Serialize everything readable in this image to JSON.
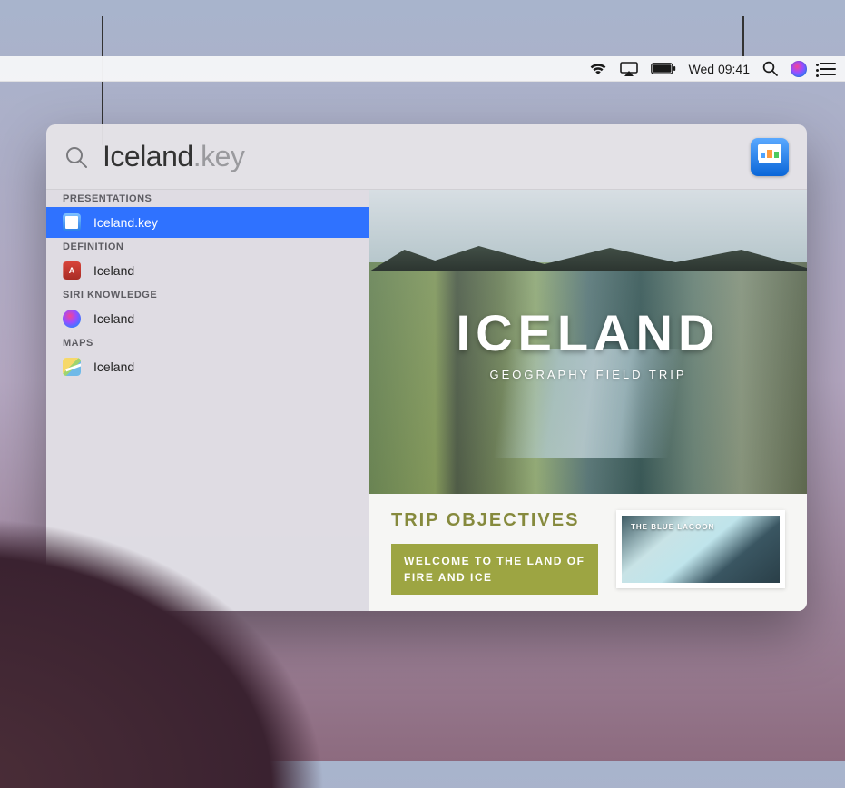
{
  "menubar": {
    "datetime": "Wed 09:41"
  },
  "spotlight": {
    "query_typed": "Iceland",
    "query_suggest": ".key",
    "app_hint": "Keynote",
    "categories": [
      {
        "header": "PRESENTATIONS",
        "items": [
          {
            "icon": "keynote",
            "label": "Iceland.key",
            "selected": true
          }
        ]
      },
      {
        "header": "DEFINITION",
        "items": [
          {
            "icon": "dictionary",
            "label": "Iceland",
            "selected": false
          }
        ]
      },
      {
        "header": "SIRI KNOWLEDGE",
        "items": [
          {
            "icon": "siri",
            "label": "Iceland",
            "selected": false
          }
        ]
      },
      {
        "header": "MAPS",
        "items": [
          {
            "icon": "maps",
            "label": "Iceland",
            "selected": false
          }
        ]
      }
    ]
  },
  "preview": {
    "slide1_title": "ICELAND",
    "slide1_subtitle": "GEOGRAPHY FIELD TRIP",
    "slide2_heading": "TRIP OBJECTIVES",
    "slide2_welcome": "WELCOME TO THE LAND OF FIRE AND ICE",
    "slide2_photo_label": "THE BLUE LAGOON"
  }
}
